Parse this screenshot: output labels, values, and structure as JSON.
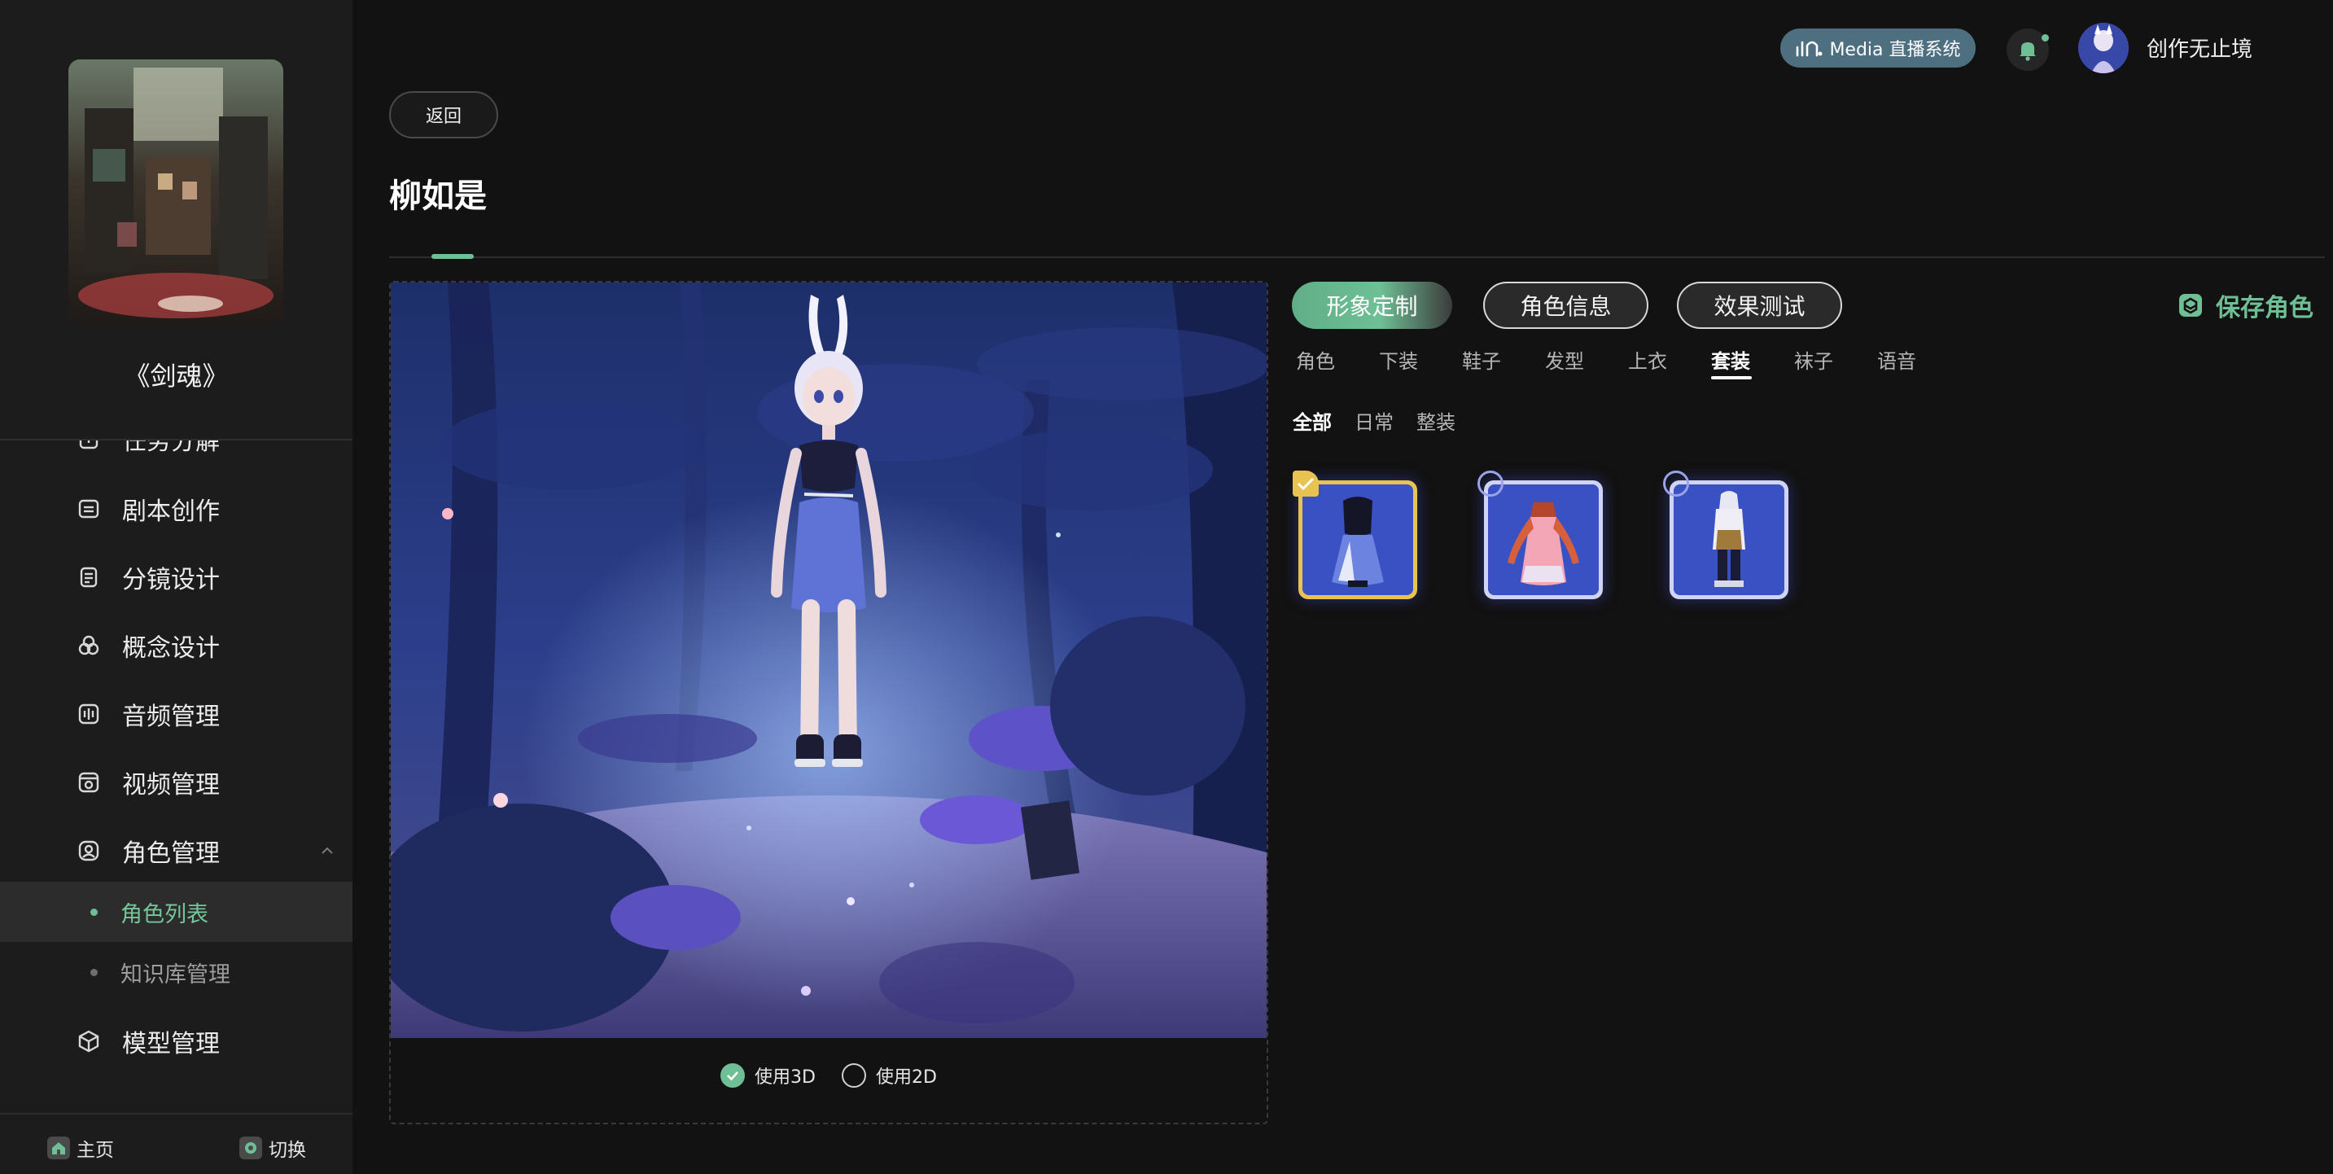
{
  "sidebar": {
    "project_title": "《剑魂》",
    "nav_items": [
      {
        "label": "任务分解",
        "icon": "task-icon"
      },
      {
        "label": "剧本创作",
        "icon": "script-icon"
      },
      {
        "label": "分镜设计",
        "icon": "storyboard-icon"
      },
      {
        "label": "概念设计",
        "icon": "concept-icon"
      },
      {
        "label": "音频管理",
        "icon": "audio-icon"
      },
      {
        "label": "视频管理",
        "icon": "video-icon"
      },
      {
        "label": "角色管理",
        "icon": "character-icon"
      },
      {
        "label": "模型管理",
        "icon": "model-icon"
      }
    ],
    "sub_items": [
      {
        "label": "角色列表",
        "active": true
      },
      {
        "label": "知识库管理",
        "active": false
      }
    ],
    "bottom": {
      "home_label": "主页",
      "switch_label": "切换"
    }
  },
  "header": {
    "media_badge": "Media 直播系统",
    "username": "创作无止境"
  },
  "main": {
    "back_label": "返回",
    "page_title": "柳如是",
    "view_modes": [
      {
        "label": "使用3D",
        "selected": true
      },
      {
        "label": "使用2D",
        "selected": false
      }
    ],
    "main_tabs": [
      {
        "label": "形象定制",
        "active": true
      },
      {
        "label": "角色信息",
        "active": false
      },
      {
        "label": "效果测试",
        "active": false
      }
    ],
    "save_label": "保存角色",
    "categories": [
      "角色",
      "下装",
      "鞋子",
      "发型",
      "上衣",
      "套装",
      "袜子",
      "语音"
    ],
    "active_category": "套装",
    "sub_filters": [
      "全部",
      "日常",
      "整装"
    ],
    "active_sub_filter": "全部",
    "outfits": [
      {
        "name": "black-top-blue-skirt-outfit",
        "selected": true
      },
      {
        "name": "pink-dress-outfit",
        "selected": false
      },
      {
        "name": "hooded-adventurer-outfit",
        "selected": false
      }
    ]
  },
  "colors": {
    "accent": "#6fbf96",
    "selected_border": "#e8c34f",
    "media_badge": "#4d6f80",
    "background": "#121212",
    "sidebar": "#1c1c1c"
  }
}
